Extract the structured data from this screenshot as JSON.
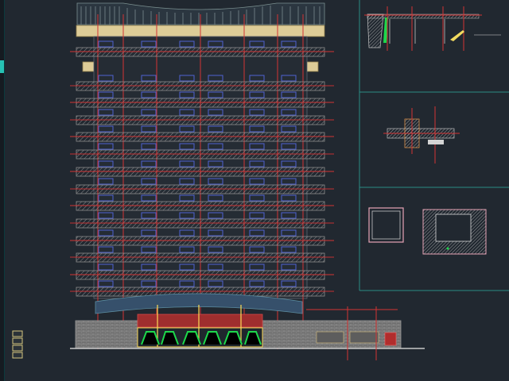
{
  "app": {
    "title": ""
  },
  "viewport": {
    "background": "#212830",
    "line_colors": {
      "grid_red": "#d43333",
      "wall_gray": "#8d8d8d",
      "window_blue": "#4f62d2",
      "panel_frame": "#2a8b84",
      "yellow": "#f2db5f",
      "green": "#1dd94c",
      "pink": "#e7a4b6"
    },
    "icons": [
      "layer-icon",
      "layer-icon",
      "layer-icon",
      "layer-icon"
    ]
  }
}
